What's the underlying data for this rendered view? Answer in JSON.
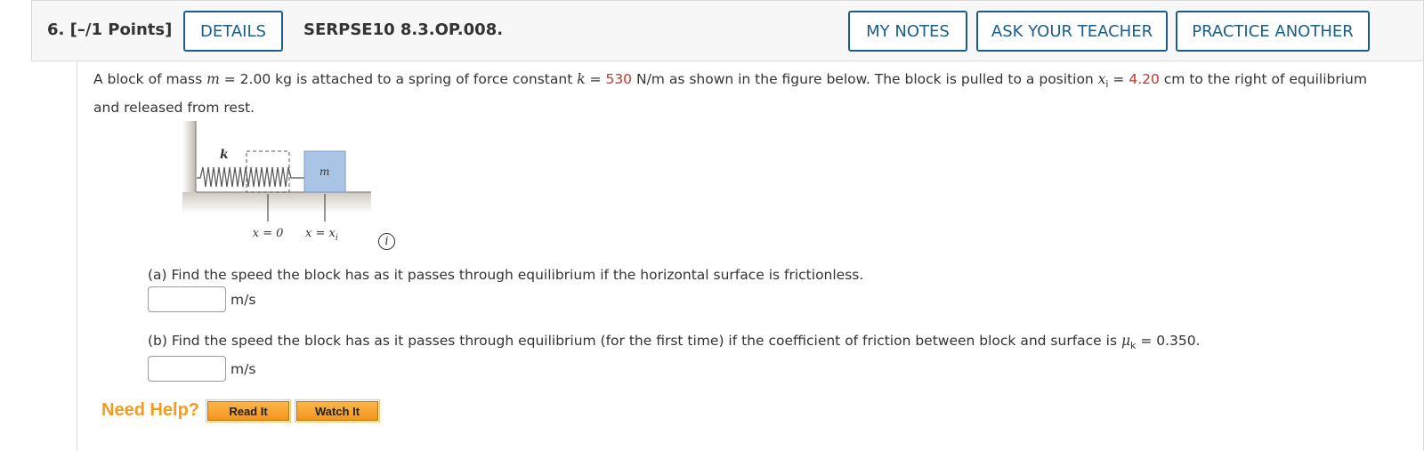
{
  "header": {
    "question_number": "6.",
    "points": "[–/1 Points]",
    "details_label": "DETAILS",
    "question_code": "SERPSE10 8.3.OP.008.",
    "my_notes_label": "MY NOTES",
    "ask_teacher_label": "ASK YOUR TEACHER",
    "practice_another_label": "PRACTICE ANOTHER"
  },
  "problem": {
    "t1": "A block of mass ",
    "m_var": "m",
    "t2": " = 2.00 kg is attached to a spring of force constant ",
    "k_var": "k",
    "t3": " = ",
    "k_value": "530",
    "t4": " N/m as shown in the figure below. The block is pulled to a position ",
    "x_var": "x",
    "x_sub": "i",
    "t5": " = ",
    "x_value": "4.20",
    "t6": " cm to the right of equilibrium and released from rest."
  },
  "figure": {
    "spring_label": "k",
    "mass_label": "m",
    "x0_label": "x = 0",
    "xi_label": "x = x",
    "xi_sub": "i",
    "info_icon_glyph": "i"
  },
  "part_a": {
    "question": "(a) Find the speed the block has as it passes through equilibrium if the horizontal surface is frictionless.",
    "answer_value": "",
    "unit": "m/s"
  },
  "part_b": {
    "question_before": "(b) Find the speed the block has as it passes through equilibrium (for the first time) if the coefficient of friction between block and surface is ",
    "mu_var": "μ",
    "mu_sub": "k",
    "question_after": " = 0.350.",
    "answer_value": "",
    "unit": "m/s"
  },
  "help": {
    "need_help_label": "Need Help?",
    "read_it_label": "Read It",
    "watch_it_label": "Watch It"
  },
  "colors": {
    "accent_blue": "#1a5c8a",
    "value_red": "#c0392b",
    "help_orange": "#f39c1f",
    "block_blue": "#a9c4e4"
  }
}
